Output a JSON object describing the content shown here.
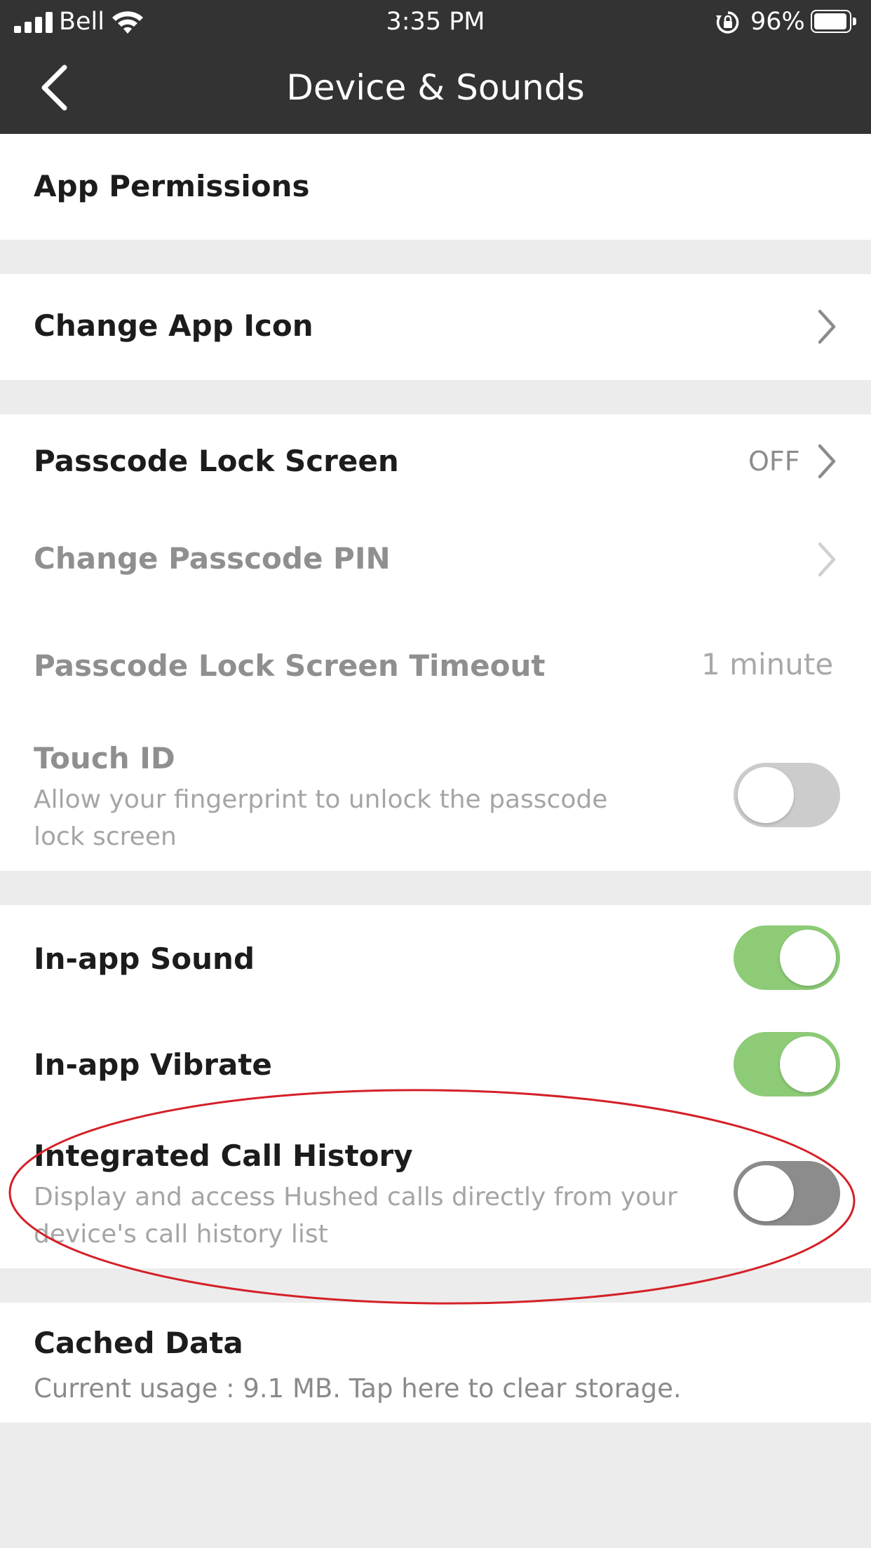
{
  "status_bar": {
    "carrier": "Bell",
    "time": "3:35 PM",
    "battery_percent": "96%",
    "battery_level": 0.96
  },
  "nav": {
    "title": "Device & Sounds"
  },
  "settings": {
    "app_permissions": {
      "label": "App Permissions"
    },
    "change_app_icon": {
      "label": "Change App Icon"
    },
    "passcode_lock_screen": {
      "label": "Passcode Lock Screen",
      "value": "OFF"
    },
    "change_passcode_pin": {
      "label": "Change Passcode PIN"
    },
    "passcode_timeout": {
      "label": "Passcode Lock Screen Timeout",
      "value": "1 minute"
    },
    "touch_id": {
      "label": "Touch ID",
      "description_line1": "Allow your fingerprint to unlock the passcode",
      "description_line2": "lock screen",
      "enabled": false
    },
    "in_app_sound": {
      "label": "In-app Sound",
      "enabled": true
    },
    "in_app_vibrate": {
      "label": "In-app Vibrate",
      "enabled": true
    },
    "integrated_call_history": {
      "label": "Integrated Call History",
      "description_line1": "Display and access Hushed calls directly from your",
      "description_line2": "device's call history list",
      "enabled": false
    },
    "cached_data": {
      "label": "Cached Data",
      "description": "Current usage : 9.1 MB. Tap here to clear storage."
    }
  },
  "colors": {
    "header_bg": "#333333",
    "toggle_on": "#8dcb77",
    "annotation_ellipse": "#d42027"
  }
}
